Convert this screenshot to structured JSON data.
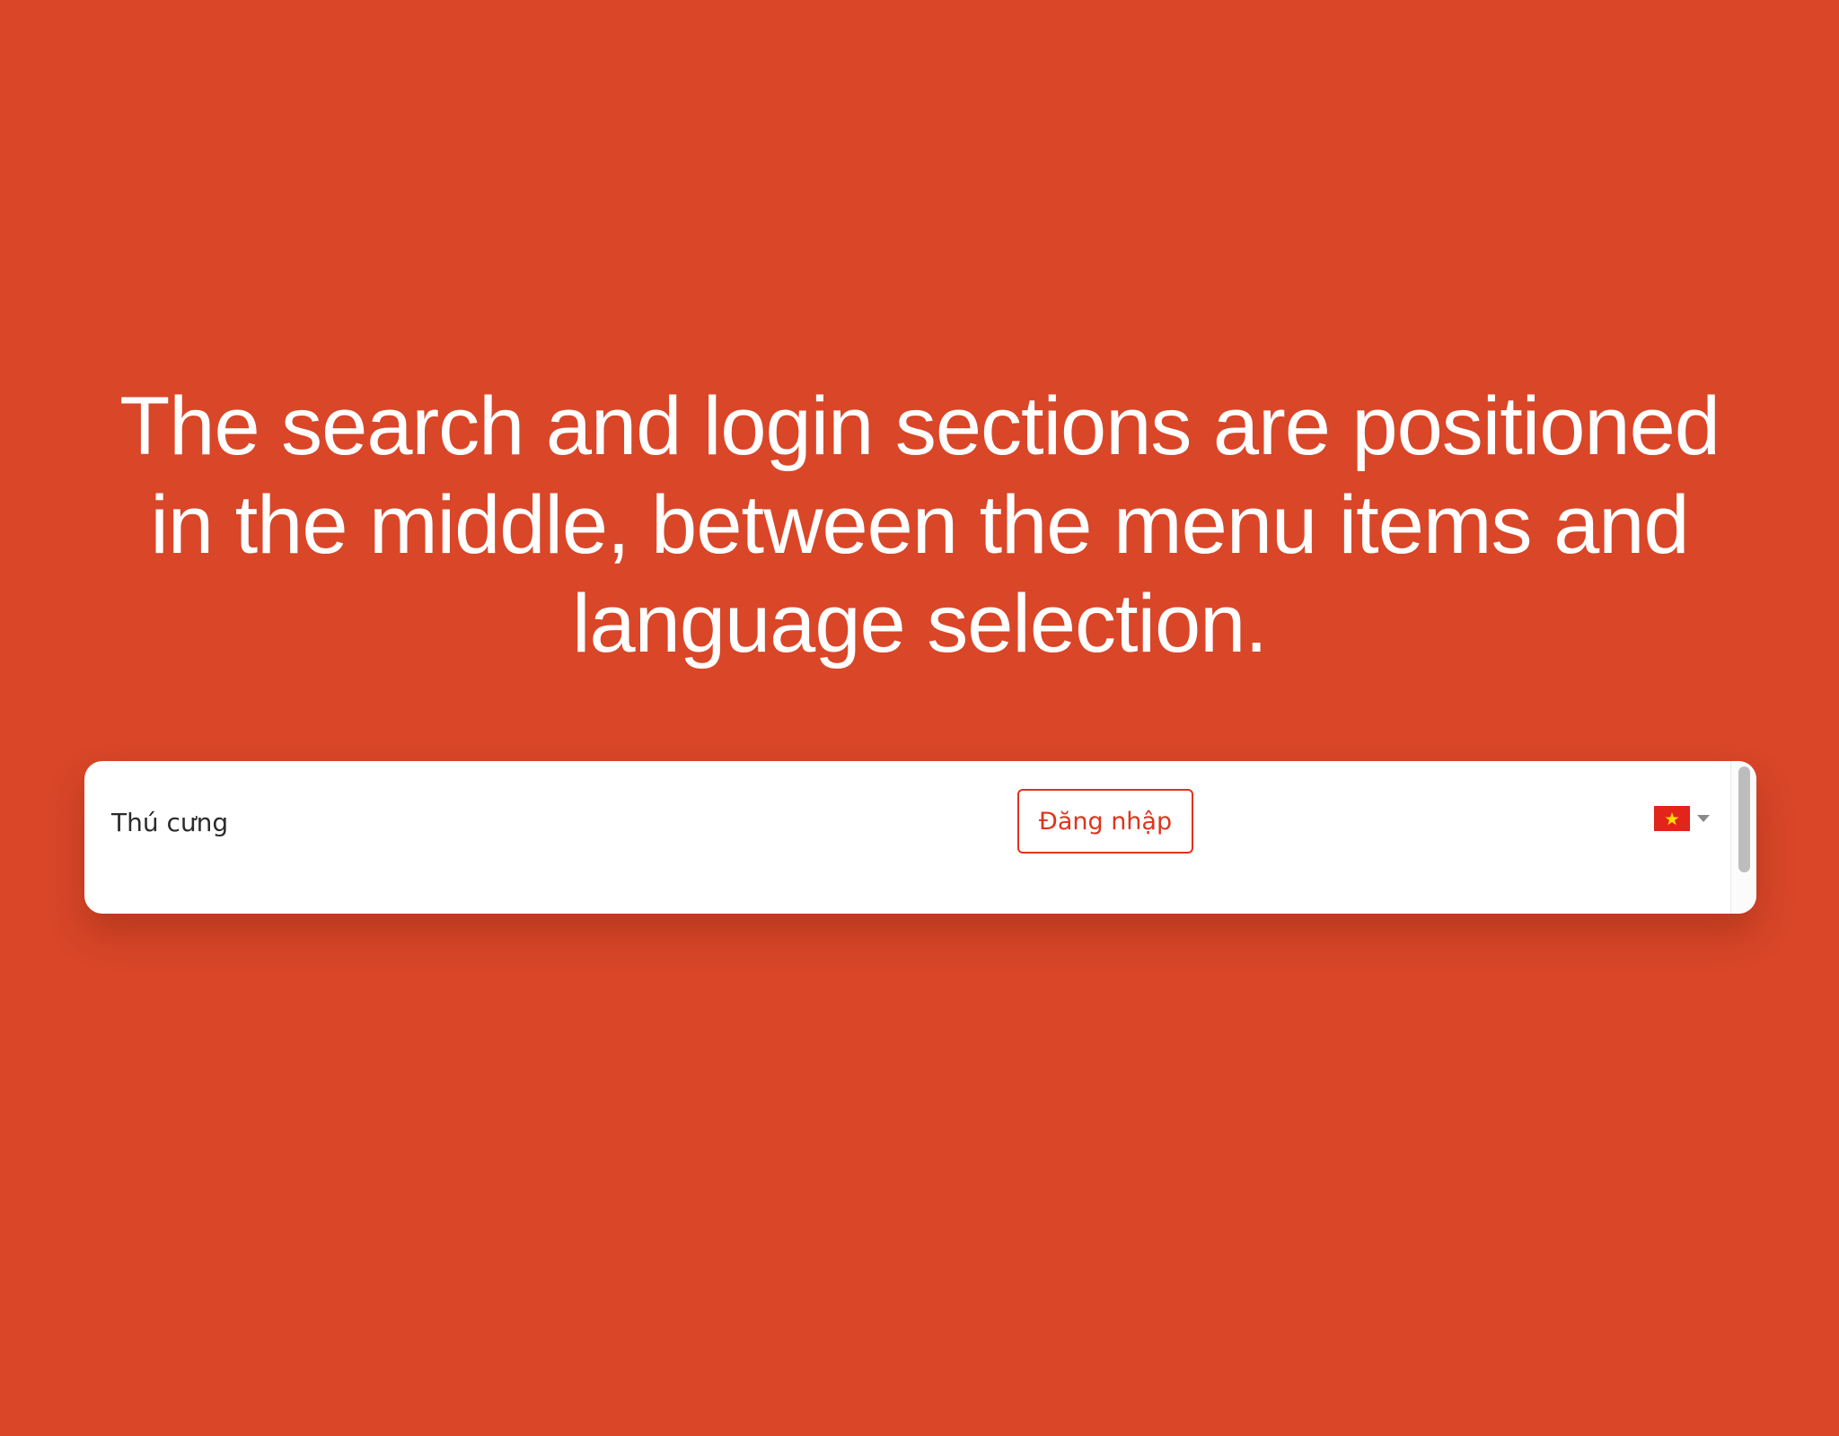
{
  "headline": {
    "line1": "The search and login sections are positioned",
    "line2": "in the middle, between the menu items and",
    "line3": "language selection."
  },
  "navbar": {
    "menu_item": "Thú cưng",
    "search_icon": "search-icon",
    "login_label": "Đăng nhập",
    "language": {
      "flag_icon": "vietnam-flag-icon",
      "caret_icon": "caret-down-icon"
    }
  },
  "colors": {
    "background": "#d94628",
    "accent": "#e0331c",
    "navbar_bg": "#ffffff",
    "text": "#2b2b2b"
  }
}
